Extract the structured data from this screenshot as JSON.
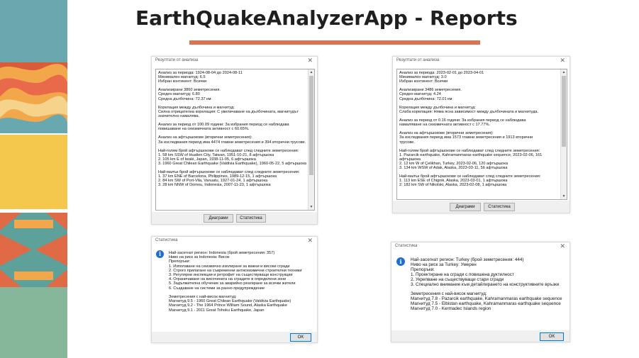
{
  "header": {
    "title": "EarthQuakeAnalyzerApp - Reports"
  },
  "windows": {
    "left_results": {
      "title": "Резултати от анализа",
      "close": "✕",
      "text": "Анализ за периода: 1924-08-04 до 2024-08-11\nМинимален магнитуд: 6.5\nИзбран континент: Всички\n\nАнализирани 3860 земетресения.\nСреден магнитуд: 6.80\nСредна дълбочина: 72.37 км\n\nКорелация между дълбочина и магнитуд:\nСилна отрицателна корелация: С увеличаване на дълбочината, магнитудът\nзначително намалява.\n\nАнализ за период от 100.09 години: За избрания период се наблюдава\nповишаване на сеизмичната активност с 60.65%.\n\nАнализ на афтършокове (вторични земетресения):\nЗа изследвания период има 4474 главни земетресения и 394 вторични трусове.\n\nНай-голям брой афтършокове се наблюдават след следните земетресения:\n1. 58 km SSW of Hualien City, Taiwan, 1951-10-21, 8 афтършока\n2. 105 km E of Iwaki, Japan, 1938-11-05, 6 афтършока\n3. 1960 Great Chilean Earthquake (Valdivia Earthquake), 1960-05-22, 5 афтършока\n\nНай-малък брой афтършокове се наблюдават след следните земетресения:\n1. 37 km ENE of Barcelona, Philippines, 1989-12-15, 1 афтършока\n2. 84 km SW of Port-Vila, Vanuatu, 1927-01-24, 1 афтършока\n3. 28 km NNW of Domou, Indonesia, 2007-11-23, 1 афтършока",
      "btn_charts": "Диаграми",
      "btn_stats": "Статистика"
    },
    "right_results": {
      "title": "Резултати от анализа",
      "close": "✕",
      "text": "Анализ за периода: 2023-02-01 до 2023-04-01\nМинимален магнитуд: 3.0\nИзбран континент: Всички\n\nАнализирани 3486 земетресения.\nСреден магнитуд: 4.24\nСредна дълбочина: 72.01 км\n\nКорелация между дълбочина и магнитуд:\nСлаба корелация: Няма ясна зависимост между дълбочината и магнитуда.\n\nАнализ за период от 0.16 години: За избрания период се наблюдава\nнамаляване на сеизмичната активност с 17.77%.\n\nАнализ на афтършокове (вторични земетресения):\nЗа изследвания период има 1573 главни земетресения и 1913 вторични\nтрусове.\n\nНай-голям брой афтършокове се наблюдават след следните земетресения:\n1. Pazarcik earthquake, Kahramanmaras earthquake sequence, 2023-02-06, 161\nафтършока\n2. 12 km W of Çelikhan, Turkey, 2023-02-06, 120 афтършока\n3. 134 km WSW of Adak, Alaska, 2023-03-11, 56 афтършока\n\nНай-малък брой афтършокове се наблюдават след следните земетресения:\n1. 113 km ESE of Chignik, Alaska, 2023-03-01, 1 афтършока\n2. 182 km SW of Nikolski, Alaska, 2023-02-08, 1 афтършока",
      "btn_charts": "Диаграми",
      "btn_stats": "Статистика"
    },
    "left_stats": {
      "title": "Статистика",
      "close": "✕",
      "icon": "i",
      "text": "Най-засегнат регион: Indonesia (брой земетресения: 357)\nНиво на риск за Indonesia: Висок\nПрепоръки:\n1. Използване на сеизмично изолиране за важни и високи сгради\n2. Строго прилагане на съвременни антисеизмични строителни техники\n3. Регулярни инспекции и ретрофит на съществуващи конструкции\n4. Ограничаване на височината на сградите в определени зони\n5. Задължителна обучение за аварийно реагиране за всички жители\n6. Създаване на системи за ранно предупреждение\n\nЗеметресения с най-висок магнитуд:\nМагнитуд 9.5 - 1960 Great Chilean Earthquake (Valdivia Earthquake)\nМагнитуд 9.2 - The 1964 Prince William Sound, Alaska Earthquake\nМагнитуд 9.1 - 2011 Great Tohoku Earthquake, Japan",
      "ok": "OK"
    },
    "right_stats": {
      "title": "Статистика",
      "close": "✕",
      "icon": "i",
      "text": "Най-засегнат регион: Turkey (брой земетресения: 444)\nНиво на риск за Turkey: Умерен\nПрепоръки:\n1. Проектиране на сгради с повишена дуктилност\n2. Укрепване на съществуващи стари сгради\n3. Специално внимание към детайлирането на конструктивните връзки\n\nЗеметресения с най-висок магнитуд:\nМагнитуд 7.8 - Pazarcik earthquake, Kahramanmaras earthquake sequence\nМагнитуд 7.5 - Elbistan earthquake, Kahramanmaras earthquake sequence\nМагнитуд 7.0 - Kermadec Islands region",
      "ok": "OK"
    }
  },
  "colors": {
    "accent": "#e0714f",
    "teal": "#5ea4ad",
    "yellow": "#f4c94a",
    "green": "#86b79a"
  }
}
